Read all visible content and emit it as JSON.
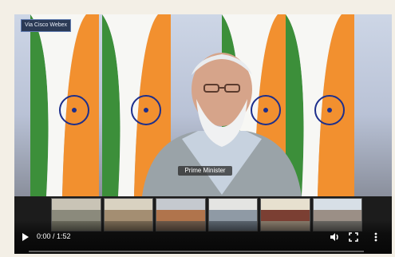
{
  "player": {
    "watermark": "Via Cisco Webex",
    "speaker_caption": "Prime Minister",
    "current_time": "0:00",
    "duration": "1:52",
    "time_separator": " / ",
    "progress_fraction": 0.0
  },
  "colors": {
    "saffron": "#f2902f",
    "white": "#f7f7f4",
    "green": "#3c8f3a",
    "chakra": "#1d2f8c"
  },
  "icons": {
    "play": "play-icon",
    "volume": "volume-icon",
    "fullscreen": "fullscreen-icon",
    "more": "more-vertical-icon"
  }
}
